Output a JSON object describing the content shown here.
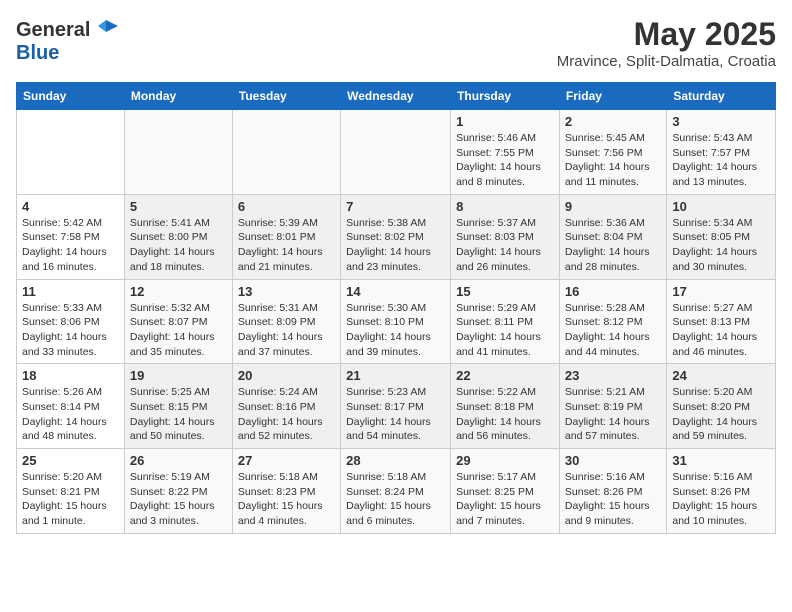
{
  "header": {
    "logo_line1": "General",
    "logo_line2": "Blue",
    "main_title": "May 2025",
    "subtitle": "Mravince, Split-Dalmatia, Croatia"
  },
  "columns": [
    "Sunday",
    "Monday",
    "Tuesday",
    "Wednesday",
    "Thursday",
    "Friday",
    "Saturday"
  ],
  "weeks": [
    {
      "days": [
        {
          "num": "",
          "info": ""
        },
        {
          "num": "",
          "info": ""
        },
        {
          "num": "",
          "info": ""
        },
        {
          "num": "",
          "info": ""
        },
        {
          "num": "1",
          "info": "Sunrise: 5:46 AM\nSunset: 7:55 PM\nDaylight: 14 hours and 8 minutes."
        },
        {
          "num": "2",
          "info": "Sunrise: 5:45 AM\nSunset: 7:56 PM\nDaylight: 14 hours and 11 minutes."
        },
        {
          "num": "3",
          "info": "Sunrise: 5:43 AM\nSunset: 7:57 PM\nDaylight: 14 hours and 13 minutes."
        }
      ]
    },
    {
      "days": [
        {
          "num": "4",
          "info": "Sunrise: 5:42 AM\nSunset: 7:58 PM\nDaylight: 14 hours and 16 minutes."
        },
        {
          "num": "5",
          "info": "Sunrise: 5:41 AM\nSunset: 8:00 PM\nDaylight: 14 hours and 18 minutes."
        },
        {
          "num": "6",
          "info": "Sunrise: 5:39 AM\nSunset: 8:01 PM\nDaylight: 14 hours and 21 minutes."
        },
        {
          "num": "7",
          "info": "Sunrise: 5:38 AM\nSunset: 8:02 PM\nDaylight: 14 hours and 23 minutes."
        },
        {
          "num": "8",
          "info": "Sunrise: 5:37 AM\nSunset: 8:03 PM\nDaylight: 14 hours and 26 minutes."
        },
        {
          "num": "9",
          "info": "Sunrise: 5:36 AM\nSunset: 8:04 PM\nDaylight: 14 hours and 28 minutes."
        },
        {
          "num": "10",
          "info": "Sunrise: 5:34 AM\nSunset: 8:05 PM\nDaylight: 14 hours and 30 minutes."
        }
      ]
    },
    {
      "days": [
        {
          "num": "11",
          "info": "Sunrise: 5:33 AM\nSunset: 8:06 PM\nDaylight: 14 hours and 33 minutes."
        },
        {
          "num": "12",
          "info": "Sunrise: 5:32 AM\nSunset: 8:07 PM\nDaylight: 14 hours and 35 minutes."
        },
        {
          "num": "13",
          "info": "Sunrise: 5:31 AM\nSunset: 8:09 PM\nDaylight: 14 hours and 37 minutes."
        },
        {
          "num": "14",
          "info": "Sunrise: 5:30 AM\nSunset: 8:10 PM\nDaylight: 14 hours and 39 minutes."
        },
        {
          "num": "15",
          "info": "Sunrise: 5:29 AM\nSunset: 8:11 PM\nDaylight: 14 hours and 41 minutes."
        },
        {
          "num": "16",
          "info": "Sunrise: 5:28 AM\nSunset: 8:12 PM\nDaylight: 14 hours and 44 minutes."
        },
        {
          "num": "17",
          "info": "Sunrise: 5:27 AM\nSunset: 8:13 PM\nDaylight: 14 hours and 46 minutes."
        }
      ]
    },
    {
      "days": [
        {
          "num": "18",
          "info": "Sunrise: 5:26 AM\nSunset: 8:14 PM\nDaylight: 14 hours and 48 minutes."
        },
        {
          "num": "19",
          "info": "Sunrise: 5:25 AM\nSunset: 8:15 PM\nDaylight: 14 hours and 50 minutes."
        },
        {
          "num": "20",
          "info": "Sunrise: 5:24 AM\nSunset: 8:16 PM\nDaylight: 14 hours and 52 minutes."
        },
        {
          "num": "21",
          "info": "Sunrise: 5:23 AM\nSunset: 8:17 PM\nDaylight: 14 hours and 54 minutes."
        },
        {
          "num": "22",
          "info": "Sunrise: 5:22 AM\nSunset: 8:18 PM\nDaylight: 14 hours and 56 minutes."
        },
        {
          "num": "23",
          "info": "Sunrise: 5:21 AM\nSunset: 8:19 PM\nDaylight: 14 hours and 57 minutes."
        },
        {
          "num": "24",
          "info": "Sunrise: 5:20 AM\nSunset: 8:20 PM\nDaylight: 14 hours and 59 minutes."
        }
      ]
    },
    {
      "days": [
        {
          "num": "25",
          "info": "Sunrise: 5:20 AM\nSunset: 8:21 PM\nDaylight: 15 hours and 1 minute."
        },
        {
          "num": "26",
          "info": "Sunrise: 5:19 AM\nSunset: 8:22 PM\nDaylight: 15 hours and 3 minutes."
        },
        {
          "num": "27",
          "info": "Sunrise: 5:18 AM\nSunset: 8:23 PM\nDaylight: 15 hours and 4 minutes."
        },
        {
          "num": "28",
          "info": "Sunrise: 5:18 AM\nSunset: 8:24 PM\nDaylight: 15 hours and 6 minutes."
        },
        {
          "num": "29",
          "info": "Sunrise: 5:17 AM\nSunset: 8:25 PM\nDaylight: 15 hours and 7 minutes."
        },
        {
          "num": "30",
          "info": "Sunrise: 5:16 AM\nSunset: 8:26 PM\nDaylight: 15 hours and 9 minutes."
        },
        {
          "num": "31",
          "info": "Sunrise: 5:16 AM\nSunset: 8:26 PM\nDaylight: 15 hours and 10 minutes."
        }
      ]
    }
  ]
}
